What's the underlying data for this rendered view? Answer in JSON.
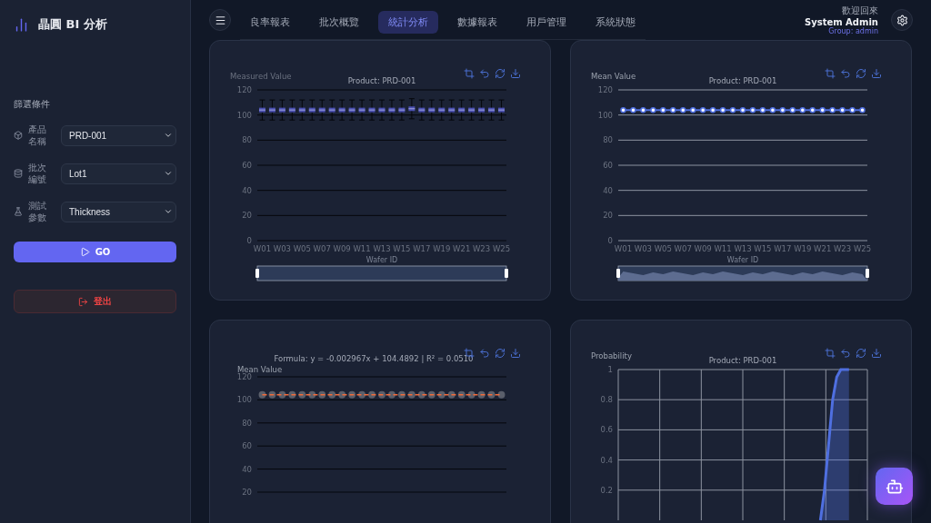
{
  "sidebar": {
    "logo": "晶圓 BI 分析",
    "filter_title": "篩選條件",
    "filters": [
      {
        "kind": "product",
        "label": "產品名稱",
        "value": "PRD-001"
      },
      {
        "kind": "lot",
        "label": "批次編號",
        "value": "Lot1"
      },
      {
        "kind": "param",
        "label": "測試參數",
        "value": "Thickness"
      }
    ],
    "go_button": "GO",
    "logout_button": "登出"
  },
  "tabs": [
    {
      "label": "良率報表",
      "selected": false
    },
    {
      "label": "批次概覽",
      "selected": false
    },
    {
      "label": "統計分析",
      "selected": true
    },
    {
      "label": "數據報表",
      "selected": false
    },
    {
      "label": "用戶管理",
      "selected": false
    },
    {
      "label": "系統狀態",
      "selected": false
    }
  ],
  "user": {
    "greeting": "歡迎回來",
    "name": "System Admin",
    "group": "Group: admin"
  },
  "cards": [
    {
      "chart_data": {
        "type": "scatter",
        "title": "Product: PRD-001",
        "ylabel": "Measured Value",
        "xlabel": "Wafer ID",
        "grid": true,
        "ylim": [
          0,
          120
        ],
        "yticks": [
          0,
          20,
          40,
          60,
          80,
          100,
          120
        ],
        "categories": [
          "W01",
          null,
          "W03",
          null,
          "W05",
          null,
          "W07",
          null,
          "W09",
          null,
          "W11",
          null,
          "W13",
          null,
          "W15",
          null,
          "W17",
          null,
          "W19",
          null,
          "W21",
          null,
          "W23",
          null,
          "W25"
        ],
        "series": [
          {
            "color": "#4a4fb0",
            "marker": "square",
            "values": [
              104,
              104,
              104,
              104,
              104,
              104,
              104,
              104,
              104,
              104,
              104,
              104,
              104,
              104,
              104,
              105,
              104,
              104,
              104,
              104,
              104,
              104,
              104,
              104,
              104
            ]
          }
        ]
      }
    },
    {
      "chart_data": {
        "type": "line",
        "title": "Product: PRD-001",
        "ylabel": "Mean Value",
        "xlabel": "Wafer ID",
        "grid": true,
        "ylim": [
          0,
          120
        ],
        "yticks": [
          0,
          20,
          40,
          60,
          80,
          100,
          120
        ],
        "categories": [
          "W01",
          null,
          "W03",
          null,
          "W05",
          null,
          "W07",
          null,
          "W09",
          null,
          "W11",
          null,
          "W13",
          null,
          "W15",
          null,
          "W17",
          null,
          "W19",
          null,
          "W21",
          null,
          "W23",
          null,
          "W25"
        ],
        "series": [
          {
            "color": "#4f6fe0",
            "marker": "circle",
            "values": [
              104,
              104,
              104,
              104,
              104,
              104,
              104,
              104,
              104,
              104,
              104,
              104,
              104,
              104,
              104,
              104,
              104,
              104,
              104,
              104,
              104,
              104,
              104,
              104,
              104
            ]
          }
        ]
      }
    },
    {
      "chart_data": {
        "type": "scatter",
        "title": "Formula: y = -0.002967x + 104.4892 | R² = 0.0510",
        "ylabel": "Mean Value",
        "grid": true,
        "ylim": [
          20,
          120
        ],
        "yticks": [
          20,
          40,
          60,
          80,
          100,
          120
        ],
        "categories": [
          null,
          null,
          null,
          null,
          null,
          null,
          null,
          null,
          null,
          null,
          null,
          null,
          null,
          null,
          null,
          null,
          null,
          null,
          null,
          null,
          null,
          null,
          null,
          null,
          null
        ],
        "series": [
          {
            "color": "#5a5f6b",
            "marker": "circle",
            "values": [
              104.5,
              104.5,
              104.5,
              104.5,
              104.5,
              104.5,
              104.5,
              104.5,
              104.5,
              104.5,
              104.5,
              104.5,
              104.5,
              104.5,
              104.5,
              104.5,
              104.5,
              104.5,
              104.5,
              104.5,
              104.5,
              104.5,
              104.5,
              104.5,
              104.5
            ]
          },
          {
            "color": "#f26b3a",
            "type": "line",
            "line_style": "dashed",
            "values": [
              104.5,
              104.5,
              104.5,
              104.5,
              104.5,
              104.5,
              104.5,
              104.5,
              104.5,
              104.5,
              104.5,
              104.5,
              104.5,
              104.5,
              104.5,
              104.5,
              104.5,
              104.5,
              104.5,
              104.5,
              104.5,
              104.5,
              104.5,
              104.5,
              104.5
            ]
          }
        ]
      }
    },
    {
      "chart_data": {
        "type": "area",
        "title": "Product: PRD-001",
        "ylabel": "Probability",
        "grid": true,
        "ylim": [
          0,
          1
        ],
        "yticks": [
          0.2,
          0.4,
          0.6,
          0.8,
          1
        ],
        "categories": [
          null,
          null,
          null,
          null,
          null,
          null,
          null,
          null,
          null,
          null,
          null,
          null,
          null,
          null,
          null,
          null,
          null,
          null,
          null,
          null,
          null,
          null,
          null,
          null,
          null,
          null,
          null,
          null,
          null,
          null,
          null,
          null,
          null,
          null,
          null,
          null,
          null,
          null,
          null,
          null,
          null,
          null,
          null,
          null,
          null,
          null,
          null,
          null,
          null,
          null,
          null,
          null,
          null,
          null,
          null,
          null,
          null,
          null,
          null,
          null,
          null
        ],
        "series": [
          {
            "color": "#4f6fe0",
            "values": [
              null,
              null,
              null,
              null,
              null,
              null,
              null,
              null,
              null,
              null,
              null,
              null,
              null,
              null,
              null,
              null,
              null,
              null,
              null,
              null,
              null,
              null,
              null,
              null,
              null,
              null,
              null,
              null,
              null,
              null,
              null,
              null,
              null,
              null,
              null,
              null,
              null,
              null,
              null,
              null,
              null,
              null,
              null,
              null,
              null,
              null,
              null,
              null,
              null,
              0,
              0.2,
              0.5,
              0.8,
              0.95,
              1,
              1,
              1,
              null,
              null,
              null,
              null
            ]
          }
        ]
      }
    }
  ]
}
